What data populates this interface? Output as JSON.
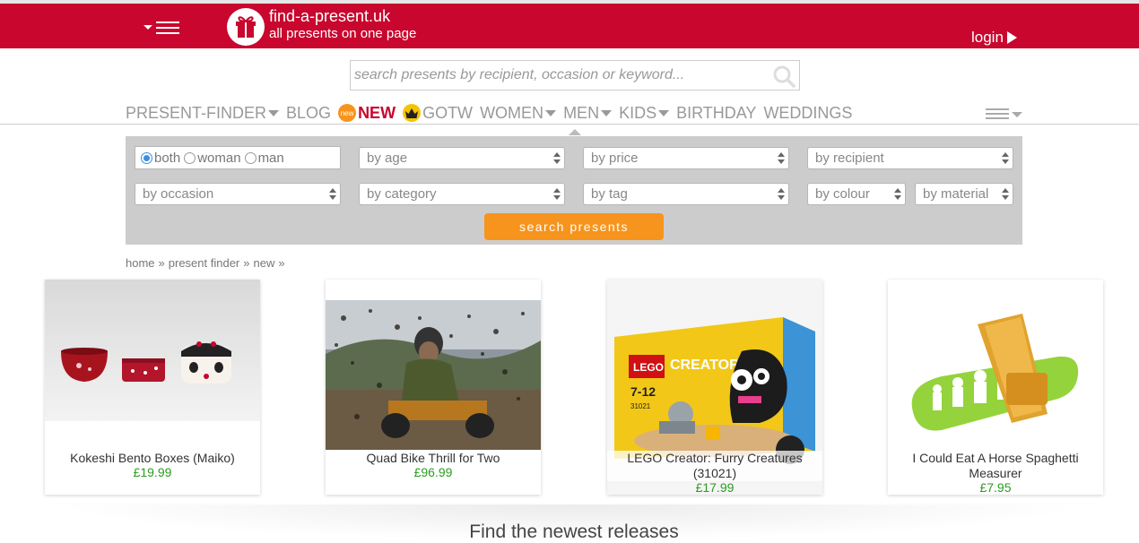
{
  "header": {
    "brand_name": "find-a-present.uk",
    "brand_tagline": "all presents on one page",
    "login_label": "login"
  },
  "search": {
    "placeholder": "search presents by recipient, occasion or keyword..."
  },
  "nav": {
    "present_finder": "PRESENT-FINDER",
    "blog": "BLOG",
    "new_badge": "new",
    "new": "NEW",
    "gotw": "GOTW",
    "women": "WOMEN",
    "men": "MEN",
    "kids": "KIDS",
    "birthday": "BIRTHDAY",
    "weddings": "WEDDINGS"
  },
  "finder": {
    "gender_options": [
      "both",
      "woman",
      "man"
    ],
    "gender_selected": "both",
    "by_age": "by age",
    "by_price": "by price",
    "by_recipient": "by recipient",
    "by_occasion": "by occasion",
    "by_category": "by category",
    "by_tag": "by tag",
    "by_colour": "by colour",
    "by_material": "by material",
    "search_button": "search presents"
  },
  "breadcrumb": [
    "home",
    "present finder",
    "new"
  ],
  "breadcrumb_separator": "»",
  "products": [
    {
      "title": "Kokeshi Bento Boxes (Maiko)",
      "price": "£19.99"
    },
    {
      "title": "Quad Bike Thrill for Two",
      "price": "£96.99"
    },
    {
      "title": "LEGO Creator: Furry Creatures (31021)",
      "price": "£17.99",
      "box_brand": "LEGO",
      "box_line": "CREATOR",
      "box_age": "7-12",
      "box_set": "31021"
    },
    {
      "title": "I Could Eat A Horse Spaghetti Measurer",
      "price": "£7.95"
    }
  ],
  "section_heading": "Find the newest releases",
  "colors": {
    "brand_red": "#c8062e",
    "accent_orange": "#f7941d",
    "price_green": "#2a9c1f",
    "finder_bg": "#cccccc"
  }
}
